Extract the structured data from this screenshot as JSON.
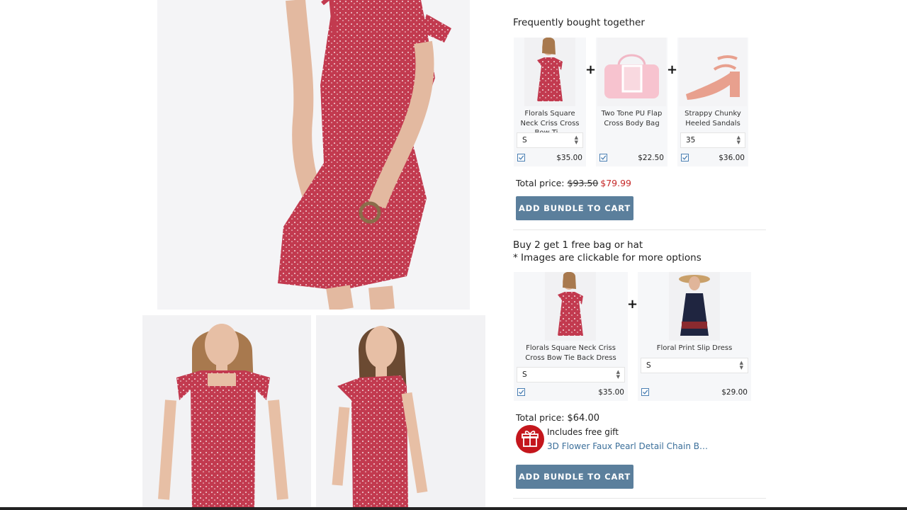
{
  "bundle1": {
    "title": "Frequently bought together",
    "items": [
      {
        "name": "Florals Square Neck Criss Cross Bow Ti…",
        "size": "S",
        "price": "$35.00"
      },
      {
        "name": "Two Tone PU Flap Cross Body Bag",
        "price": "$22.50"
      },
      {
        "name": "Strappy Chunky Heeled Sandals",
        "size": "35",
        "price": "$36.00"
      }
    ],
    "total_label": "Total price:",
    "old_price": "$93.50",
    "new_price": "$79.99",
    "button": "ADD BUNDLE TO CART"
  },
  "bundle2": {
    "title": "Buy 2 get 1 free bag or hat",
    "note": "* Images are clickable for more options",
    "items": [
      {
        "name": "Florals Square Neck Criss Cross Bow Tie Back Dress",
        "size": "S",
        "price": "$35.00"
      },
      {
        "name": "Floral Print Slip Dress",
        "size": "S",
        "price": "$29.00"
      }
    ],
    "total_label": "Total price:",
    "total": "$64.00",
    "gift_label": "Includes free gift",
    "gift_name": "3D Flower Faux Pearl Detail Chain B…",
    "button": "ADD BUNDLE TO CART"
  },
  "colors": {
    "accent_button": "#5b7f9c",
    "sale_price": "#c62828",
    "link": "#3b6f9a",
    "gift": "#c4161c"
  }
}
